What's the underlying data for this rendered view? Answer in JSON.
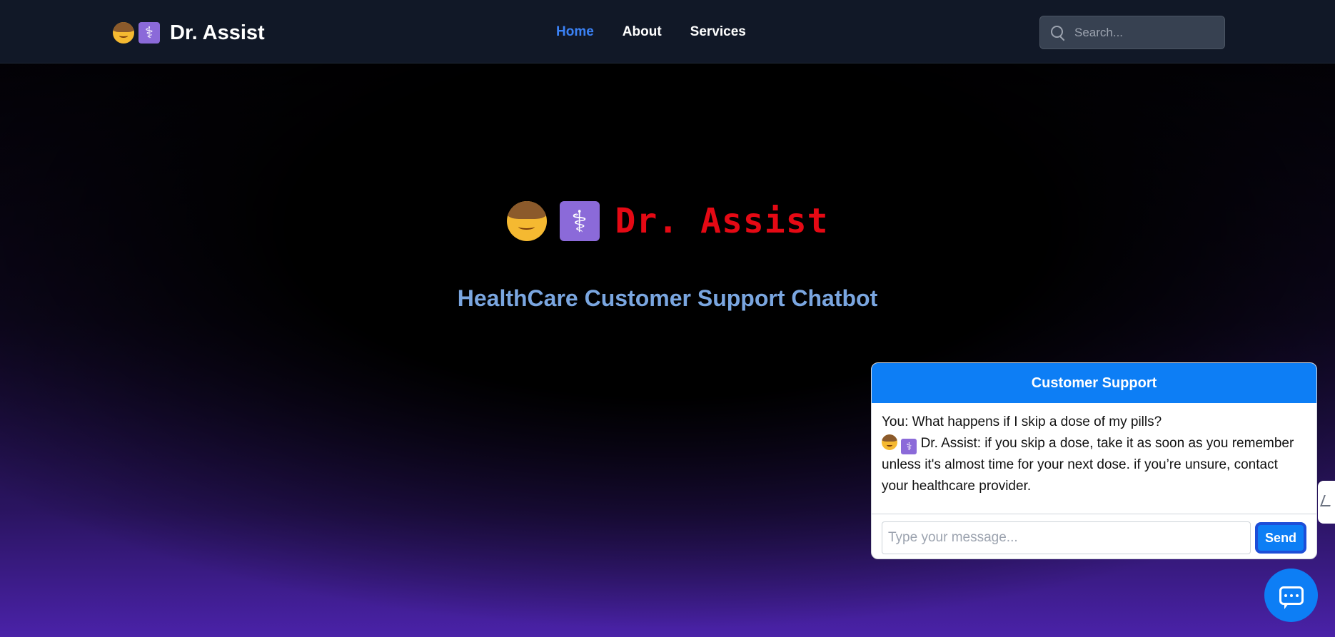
{
  "nav": {
    "brand": "Dr. Assist",
    "links": [
      "Home",
      "About",
      "Services"
    ],
    "active": "Home",
    "search_placeholder": "Search..."
  },
  "hero": {
    "title": "Dr. Assist",
    "subtitle": "HealthCare Customer Support Chatbot"
  },
  "chat": {
    "header": "Customer Support",
    "messages": [
      {
        "speaker": "You",
        "text": "You: What happens if I skip a dose of my pills?"
      },
      {
        "speaker": "Dr. Assist",
        "text": "Dr. Assist: if you skip a dose, take it as soon as you remember unless it's almost time for your next dose. if you’re unsure, contact your healthcare provider."
      }
    ],
    "input_placeholder": "Type your message...",
    "send_label": "Send"
  },
  "colors": {
    "accent": "#0d7ef5",
    "nav_active": "#3b82f6",
    "hero_title": "#e50914",
    "subtitle": "#7aa6e0"
  },
  "icons": [
    "boy-emoji-icon",
    "medical-symbol-icon",
    "search-icon",
    "chat-bubble-icon",
    "collapse-icon"
  ]
}
